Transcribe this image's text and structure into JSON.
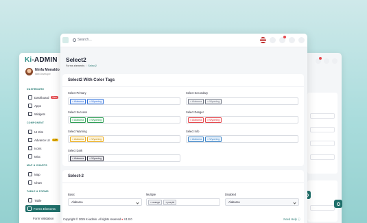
{
  "back_window": {
    "logo_prefix": "Ki",
    "logo_suffix": "-ADMIN",
    "profile_name": "Ninfa Monaldo",
    "profile_role": "Web Developer",
    "sections": [
      {
        "title": "DASHBOARD"
      },
      {
        "title": "COMPONENT"
      },
      {
        "title": "MAP & CHARTS"
      },
      {
        "title": "TABLE & FORMS"
      }
    ],
    "nav": [
      {
        "label": "Dashboard",
        "badge": "New"
      },
      {
        "label": "Apps"
      },
      {
        "label": "Widgets"
      },
      {
        "label": "UI Kits"
      },
      {
        "label": "Advance UI",
        "badge": "12+"
      },
      {
        "label": "Icons"
      },
      {
        "label": "Misc"
      },
      {
        "label": "Map"
      },
      {
        "label": "Chart"
      },
      {
        "label": "Table"
      },
      {
        "label": "Forms Elements"
      },
      {
        "label": "Form Validation"
      }
    ]
  },
  "front_window": {
    "search_placeholder": "Search...",
    "page_title": "Select2",
    "breadcrumb": {
      "parent": "Forms elements",
      "current": "Select2"
    },
    "card1_title": "Select2 With Color Tags",
    "color_fields": [
      {
        "label": "Select Primary",
        "tags": [
          "Alabama",
          "Wyoming"
        ],
        "color": "#2f6fd8",
        "bg": "#eef4ff"
      },
      {
        "label": "Select Secondary",
        "tags": [
          "Alabama",
          "Wyoming"
        ],
        "color": "#6c7280",
        "bg": "#f2f3f5"
      },
      {
        "label": "Select Success",
        "tags": [
          "Alabama",
          "Wyoming"
        ],
        "color": "#2f9e55",
        "bg": "#ecf8f0"
      },
      {
        "label": "Select Danger",
        "tags": [
          "Alabama",
          "Wyoming"
        ],
        "color": "#e5484d",
        "bg": "#fdeeee"
      },
      {
        "label": "Select Warning",
        "tags": [
          "Alabama",
          "Wyoming"
        ],
        "color": "#e9a916",
        "bg": "#fff7e2"
      },
      {
        "label": "Select Info",
        "tags": [
          "Alabama",
          "Wyoming"
        ],
        "color": "#3b82c4",
        "bg": "#eaf3fc"
      },
      {
        "label": "Select Dark",
        "tags": [
          "Alabama",
          "Wyoming"
        ],
        "color": "#2b2b3a",
        "bg": "#eeeef1"
      }
    ],
    "card2_title": "Select-2",
    "basic": {
      "label": "Basic",
      "value": "Alabama"
    },
    "multiple": {
      "label": "Multiple",
      "tags": [
        "orange",
        "purple"
      ]
    },
    "disabled": {
      "label": "Disabled",
      "value": "Alabama"
    },
    "footer_text": "Copyright © 2025 Ki-admin. All rights reserved",
    "footer_version": "V1.0.0",
    "need_help": "Need Help"
  }
}
